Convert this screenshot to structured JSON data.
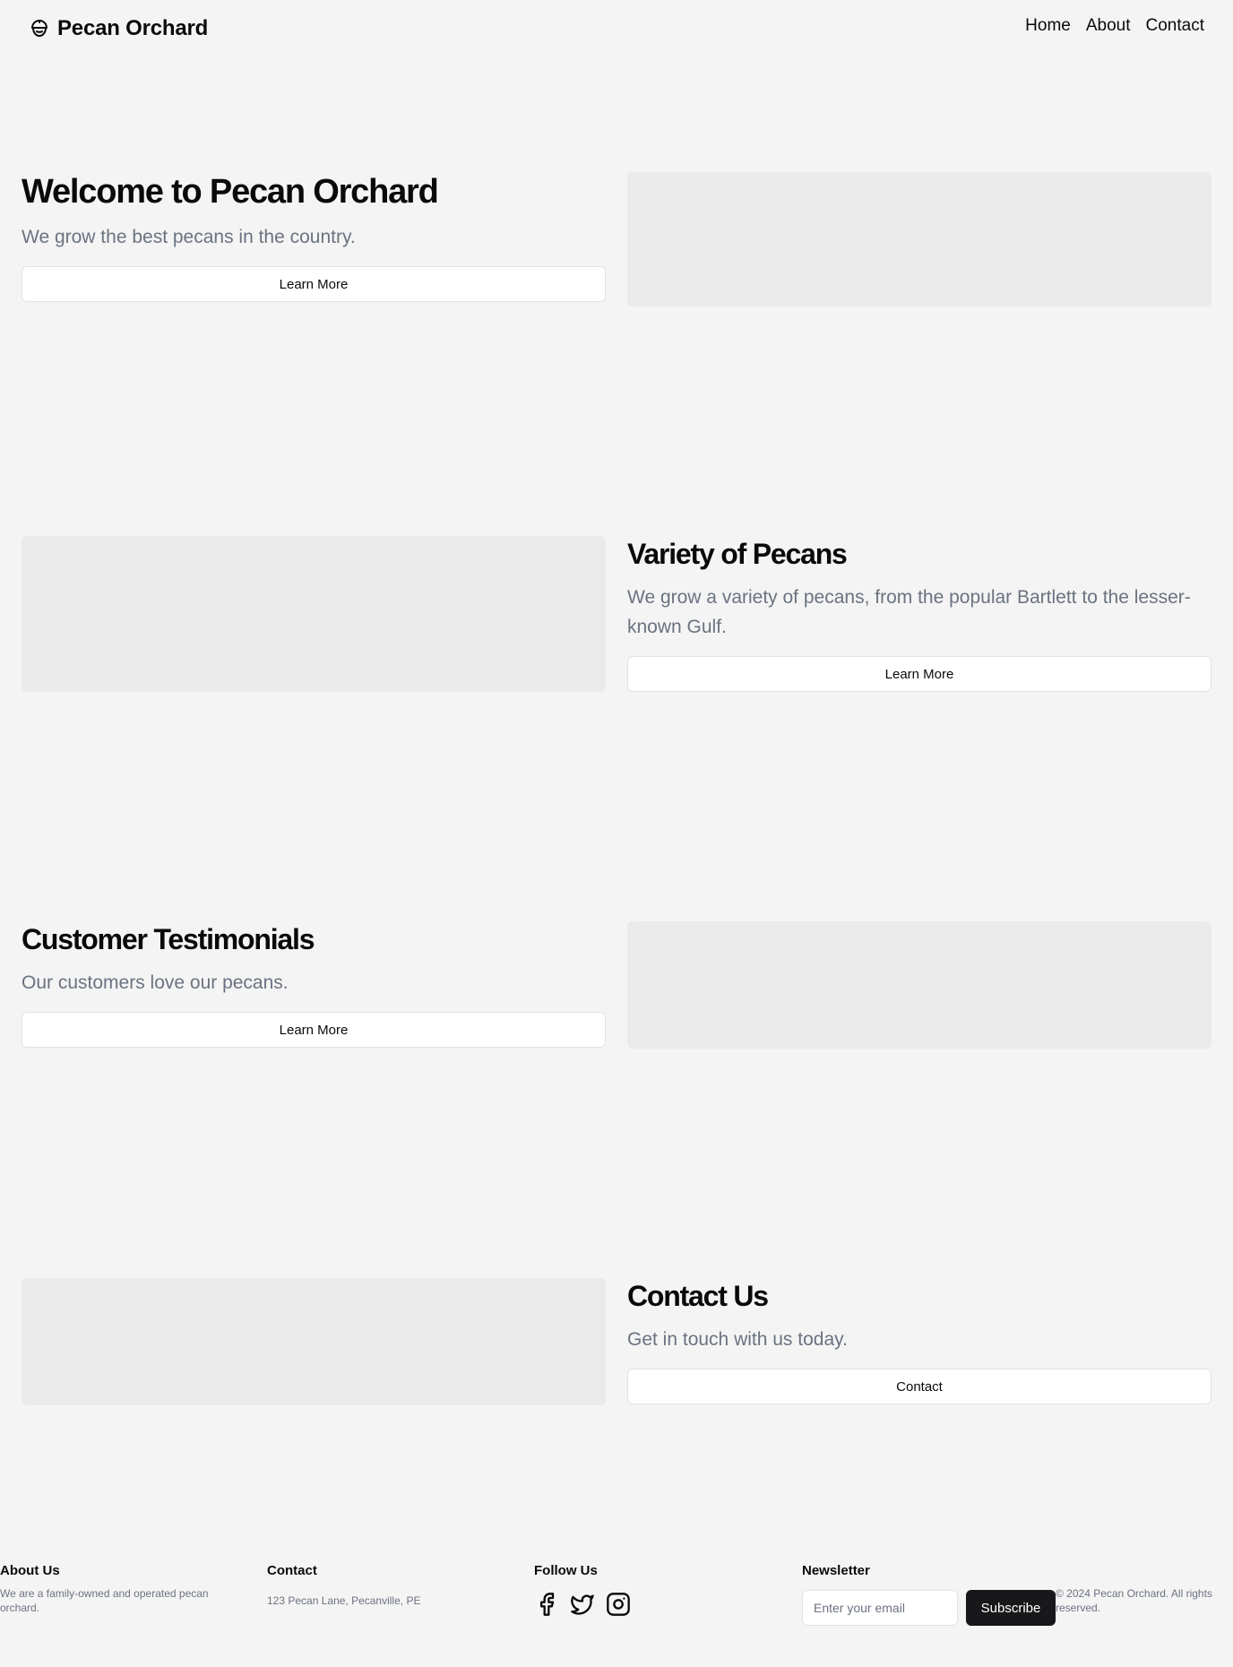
{
  "header": {
    "brand": "Pecan Orchard",
    "nav": [
      "Home",
      "About",
      "Contact"
    ]
  },
  "hero": {
    "title": "Welcome to Pecan Orchard",
    "subtitle": "We grow the best pecans in the country.",
    "button": "Learn More"
  },
  "variety": {
    "title": "Variety of Pecans",
    "subtitle": "We grow a variety of pecans, from the popular Bartlett to the lesser-known Gulf.",
    "button": "Learn More"
  },
  "testimonials": {
    "title": "Customer Testimonials",
    "subtitle": "Our customers love our pecans.",
    "button": "Learn More"
  },
  "contact": {
    "title": "Contact Us",
    "subtitle": "Get in touch with us today.",
    "button": "Contact"
  },
  "footer": {
    "about": {
      "heading": "About Us",
      "text": "We are a family-owned and operated pecan orchard."
    },
    "contact": {
      "heading": "Contact",
      "address": "123 Pecan Lane, Pecanville, PE"
    },
    "follow": {
      "heading": "Follow Us",
      "icons": [
        "facebook-icon",
        "twitter-icon",
        "instagram-icon"
      ]
    },
    "newsletter": {
      "heading": "Newsletter",
      "placeholder": "Enter your email",
      "button": "Subscribe"
    },
    "copyright": "© 2024 Pecan Orchard. All rights reserved."
  }
}
